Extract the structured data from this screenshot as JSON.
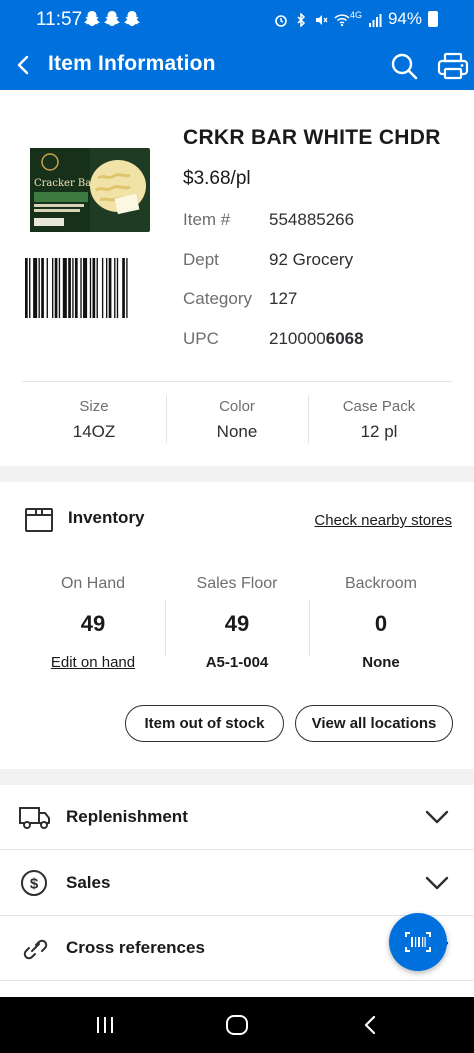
{
  "status_bar": {
    "time": "11:57",
    "network": "4G",
    "battery": "94%"
  },
  "app_bar": {
    "title": "Item Information",
    "back_icon": "back-arrow-icon",
    "search_icon": "search-icon",
    "print_icon": "printer-icon"
  },
  "item": {
    "name": "CRKR BAR WHITE CHDR",
    "price": "$3.68/pl",
    "details": [
      {
        "label": "Item #",
        "value": "554885266"
      },
      {
        "label": "Dept",
        "value": "92 Grocery"
      },
      {
        "label": "Category",
        "value": "127"
      }
    ],
    "upc_label": "UPC",
    "upc_prefix": "210000",
    "upc_suffix": "6068",
    "image_brand": "Cracker Barrel",
    "attributes": [
      {
        "label": "Size",
        "value": "14OZ"
      },
      {
        "label": "Color",
        "value": "None"
      },
      {
        "label": "Case Pack",
        "value": "12 pl"
      }
    ]
  },
  "inventory": {
    "title": "Inventory",
    "nearby_link": "Check nearby stores",
    "columns": [
      {
        "label": "On Hand",
        "value": "49",
        "sub": "Edit on hand"
      },
      {
        "label": "Sales Floor",
        "value": "49",
        "sub": "A5-1-004"
      },
      {
        "label": "Backroom",
        "value": "0",
        "sub": "None"
      }
    ],
    "buttons": {
      "out_of_stock": "Item out of stock",
      "view_locations": "View all locations"
    }
  },
  "sections": [
    {
      "title": "Replenishment",
      "icon": "truck-icon"
    },
    {
      "title": "Sales",
      "icon": "dollar-icon"
    },
    {
      "title": "Cross references",
      "icon": "link-icon"
    }
  ],
  "colors": {
    "brand_blue": "#0071dc",
    "text": "#2e2f32",
    "muted": "#6d6e71",
    "divider": "#e3e4e5",
    "band": "#f2f2f2"
  }
}
